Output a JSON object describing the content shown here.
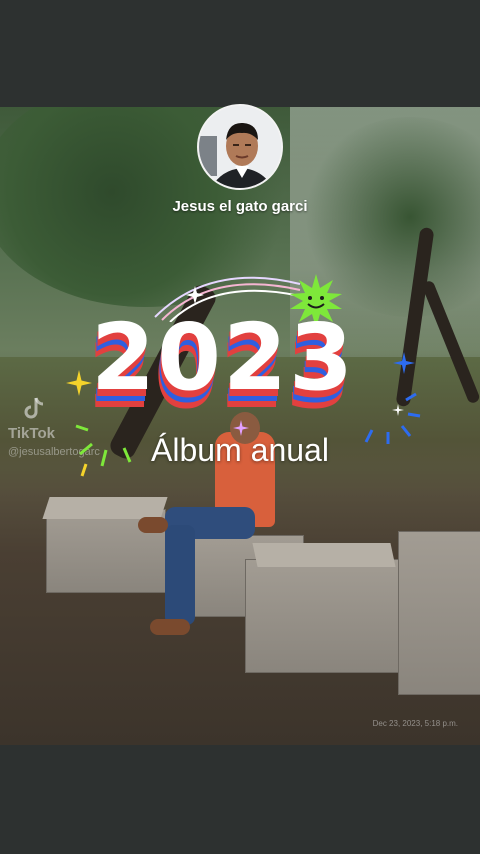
{
  "profile": {
    "username": "Jesus el gato garci"
  },
  "album": {
    "year": "2023",
    "title": "Álbum anual"
  },
  "video": {
    "watermark_brand": "TikTok",
    "watermark_user": "@jesusalbertogarc",
    "timestamp": "Dec 23, 2023, 5:18 p.m."
  },
  "colors": {
    "year_face": "#ffffff",
    "stripe_red": "#e2403f",
    "stripe_blue": "#2f5fe0",
    "stripe_yellow": "#f4d32b",
    "sparkle_green": "#7ee83a",
    "sparkle_blue": "#2d6cf0"
  },
  "icons": [
    "tiktok-logo-icon",
    "smiley-sun-icon",
    "sparkle-icon"
  ]
}
